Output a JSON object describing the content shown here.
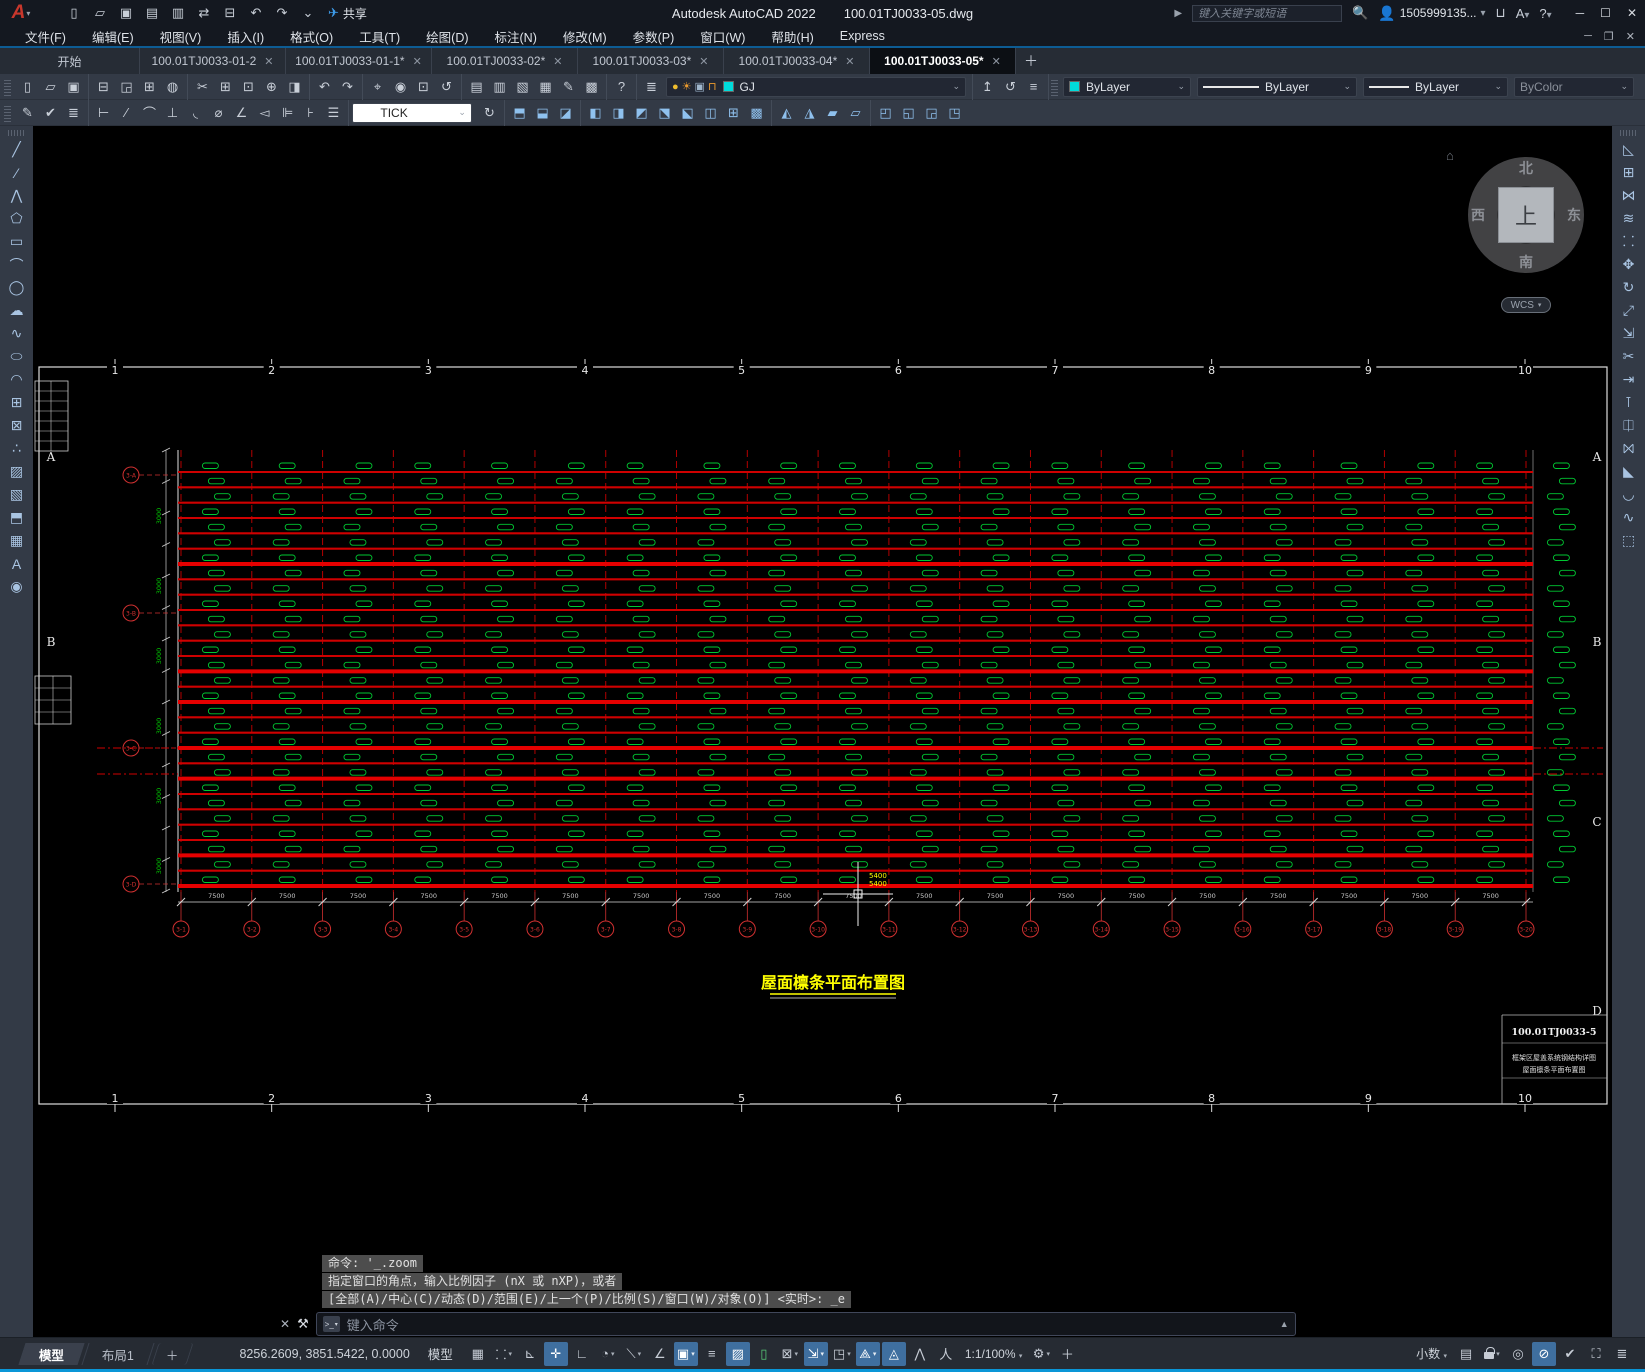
{
  "titlebar": {
    "app_title": "Autodesk AutoCAD 2022",
    "doc_title": "100.01TJ0033-05.dwg",
    "share_label": "共享",
    "search_placeholder": "键入关键字或短语",
    "username": "1505999135...",
    "qat_icons": [
      "new:▯",
      "open:▱",
      "save:▣",
      "save-as:▤",
      "plot-batch:▥",
      "transfer:⇄",
      "print:⊟",
      "undo:↶",
      "redo:↷",
      "customize:⌄"
    ],
    "right_icons": [
      "search:○",
      "user:●",
      "cart:⊔",
      "autodesk-app:A",
      "help:?"
    ],
    "window_controls": [
      "minimize:─",
      "maximize:☐",
      "close:✕"
    ],
    "doc_window_controls": [
      "minimize:─",
      "restore:❐",
      "close:✕"
    ]
  },
  "menubar": {
    "items": [
      "文件(F)",
      "编辑(E)",
      "视图(V)",
      "插入(I)",
      "格式(O)",
      "工具(T)",
      "绘图(D)",
      "标注(N)",
      "修改(M)",
      "参数(P)",
      "窗口(W)",
      "帮助(H)",
      "Express"
    ]
  },
  "tabbar": {
    "start_tab": "开始",
    "tabs": [
      {
        "label": "100.01TJ0033-01-2",
        "active": false
      },
      {
        "label": "100.01TJ0033-01-1*",
        "active": false
      },
      {
        "label": "100.01TJ0033-02*",
        "active": false
      },
      {
        "label": "100.01TJ0033-03*",
        "active": false
      },
      {
        "label": "100.01TJ0033-04*",
        "active": false
      },
      {
        "label": "100.01TJ0033-05*",
        "active": true
      }
    ],
    "close_glyph": "✕",
    "new_tab_glyph": "＋"
  },
  "toolbars": {
    "row1_groups": [
      [
        "new:▯",
        "open:▱",
        "save:▣"
      ],
      [
        "plot:⊟",
        "plot-preview:◲",
        "publish:⊞",
        "publish-web:◍"
      ],
      [
        "cut:✂",
        "copy-clip:⊞",
        "paste:⊡",
        "copy-base-point:⊕",
        "match-properties:◨"
      ],
      [
        "undo:↶",
        "redo:↷"
      ],
      [
        "pan:⌖",
        "zoom-realtime:◉",
        "zoom-window:⊡",
        "zoom-previous:↺"
      ],
      [
        "properties:▤",
        "design-center:▥",
        "tool-palettes:▧",
        "sheet-set-manager:▦",
        "markup:✎",
        "quick-calc:▩"
      ],
      [
        "help:?"
      ]
    ],
    "layer_tools": [
      "layer-properties:≣"
    ],
    "layer_state_tools": [
      "make-object-layer-current:↥",
      "layer-previous:↺",
      "layer-states:≡"
    ],
    "layer": {
      "name": "GJ",
      "swatch_color": "#00dbdb"
    },
    "color_value": "ByLayer",
    "linetype_value": "ByLayer",
    "lineweight_value": "ByLayer",
    "plotstyle_value": "ByColor",
    "dim_style": "TICK",
    "row2_groups_a": [
      [
        "edit-text:✎",
        "check-standards:✔",
        "layer-translate:≣"
      ],
      [
        "dim-linear:⊢",
        "dim-aligned:∕",
        "dim-arc-length:⌒",
        "dim-ordinate:⊥",
        "dim-radius:◟",
        "dim-diameter:⌀",
        "dim-angular:∠",
        "dim-quick:◅",
        "dim-baseline:⊫",
        "dim-continue:⊦",
        "dim-space:☰"
      ]
    ],
    "row2_groups_b": [
      [
        "dim-update:↻"
      ],
      [
        "union:⬒",
        "subtract:⬓",
        "intersect:◪"
      ],
      [
        "extrude-faces:◧",
        "move-faces:◨",
        "offset-faces:◩",
        "delete-faces:⬔",
        "rotate-faces:⬕",
        "taper-faces:◫",
        "copy-faces:⊞",
        "color-faces:▩"
      ],
      [
        "slice:◭",
        "thicken:◮",
        "imprint:▰",
        "check-interference:▱"
      ],
      [
        "clean:◰",
        "shell:◱",
        "separate:◲",
        "validate:◳"
      ]
    ]
  },
  "draw_toolbar": [
    "line:╱",
    "construction-line:⁄",
    "polyline:⋀",
    "polygon:⬠",
    "rectangle:▭",
    "arc:⌒",
    "circle:◯",
    "revision-cloud:☁",
    "spline:∿",
    "ellipse:⬭",
    "ellipse-arc:◠",
    "insert-block:⊞",
    "create-block:⊠",
    "point:∴",
    "hatch:▨",
    "gradient:▧",
    "region:⬒",
    "table:▦",
    "multiline-text:A",
    "point-style:◉"
  ],
  "modify_toolbar": [
    "erase:◺",
    "copy:⊞",
    "mirror:⋈",
    "offset:≋",
    "array:⸬",
    "move:✥",
    "rotate:↻",
    "scale:⤢",
    "stretch:⇲",
    "trim:✂",
    "extend:⇥",
    "break-at-point:⊺",
    "break:⎅",
    "join:⨝",
    "chamfer:◣",
    "fillet:◡",
    "blend-curves:∿",
    "explode:⬚"
  ],
  "viewcube": {
    "north": "北",
    "south": "南",
    "west": "西",
    "east": "东",
    "top_face": "上",
    "wcs_label": "WCS"
  },
  "drawing": {
    "grid_numbers": [
      "1",
      "2",
      "3",
      "4",
      "5",
      "6",
      "7",
      "8",
      "9",
      "10"
    ],
    "left_row_letters": [
      "A",
      "B"
    ],
    "right_row_letters": [
      "A",
      "B",
      "C",
      "D"
    ],
    "sub_axis_labels": [
      "3-1",
      "3-2",
      "3-3",
      "3-4",
      "3-5",
      "3-6",
      "3-7",
      "3-8",
      "3-9",
      "3-10",
      "3-11",
      "3-12",
      "3-13",
      "3-14",
      "3-15",
      "3-16",
      "3-17",
      "3-18",
      "3-19",
      "3-20"
    ],
    "side_axis_labels": [
      "3-A",
      "3-B",
      "3-C",
      "3-D"
    ],
    "bay_dim_label": "7500",
    "left_dim_label": "3000",
    "cursor_dim_label": "5400",
    "title": "屋面檩条平面布置图",
    "titleblock": {
      "drawing_number": "100.01TJ0033-5",
      "line1": "框架区屋盖系统钢结构详图",
      "line2": "屋面檩条平面布置图"
    },
    "purlin_rows": 28,
    "thick_rows": [
      6,
      13,
      15,
      18,
      20,
      25,
      27
    ],
    "bays": 20,
    "colors": {
      "purlin": "#cf0000",
      "purlin_thick": "#e60000",
      "grid_line": "#b30000",
      "tag": "#00c832",
      "axis_bubble": "#d03030",
      "dim_text": "#c8c8c8",
      "frame": "#dcdcdc",
      "title": "#ffff00",
      "green_dim": "#00bb00"
    }
  },
  "command": {
    "history": [
      "命令: '_.zoom",
      "指定窗口的角点，输入比例因子 (nX 或 nXP)，或者",
      "[全部(A)/中心(C)/动态(D)/范围(E)/上一个(P)/比例(S)/窗口(W)/对象(O)] <实时>: _e"
    ],
    "input_placeholder": "键入命令"
  },
  "statusbar": {
    "layout_tabs": [
      "模型",
      "布局1"
    ],
    "new_layout_glyph": "＋",
    "coordinates": "8256.2609, 3851.5422, 0.0000",
    "model_space_label": "模型",
    "toggles": [
      {
        "name": "grid-display",
        "glyph": "▦",
        "active": false,
        "dd": false
      },
      {
        "name": "snap-mode",
        "glyph": "⸬",
        "active": false,
        "dd": true
      },
      {
        "name": "infer-constraints",
        "glyph": "⊾",
        "active": false,
        "dd": false
      },
      {
        "name": "dynamic-input",
        "glyph": "✛",
        "active": true,
        "dd": false
      },
      {
        "name": "ortho-mode",
        "glyph": "∟",
        "active": false,
        "dd": false
      },
      {
        "name": "polar-tracking",
        "glyph": "◔",
        "active": false,
        "dd": true
      },
      {
        "name": "isometric-drafting",
        "glyph": "⟍",
        "active": false,
        "dd": true
      },
      {
        "name": "object-snap-tracking",
        "glyph": "∠",
        "active": false,
        "dd": false
      },
      {
        "name": "object-snap",
        "glyph": "▣",
        "active": true,
        "dd": true
      },
      {
        "name": "lineweight",
        "glyph": "≡",
        "active": false,
        "dd": false
      },
      {
        "name": "transparency",
        "glyph": "▨",
        "active": true,
        "dd": false
      },
      {
        "name": "selection-cycling",
        "glyph": "▯",
        "active": false,
        "dd": false,
        "green": true
      },
      {
        "name": "3d-object-snap",
        "glyph": "⊠",
        "active": false,
        "dd": true
      },
      {
        "name": "dynamic-ucs",
        "glyph": "⇲",
        "active": true,
        "dd": true
      },
      {
        "name": "selection-filtering",
        "glyph": "◳",
        "active": false,
        "dd": true
      },
      {
        "name": "gizmo",
        "glyph": "⟁",
        "active": true,
        "dd": true
      },
      {
        "name": "annotation-visibility",
        "glyph": "◬",
        "active": true,
        "dd": false
      },
      {
        "name": "autoscale",
        "glyph": "⋀",
        "active": false,
        "dd": false
      },
      {
        "name": "annotation-scale-flag",
        "glyph": "人",
        "active": false,
        "dd": false
      }
    ],
    "annotation_scale": "1:1/100%",
    "settings_glyph": "⚙",
    "add_glyph": "＋",
    "units_label": "小数",
    "right_icons": [
      {
        "name": "properties-palette",
        "glyph": "▤",
        "active": false,
        "dd": false
      },
      {
        "name": "lock-ui",
        "glyph": "lock",
        "active": false,
        "dd": true
      },
      {
        "name": "isolate-objects",
        "glyph": "◎",
        "active": false,
        "dd": false
      },
      {
        "name": "annotation-monitor",
        "glyph": "⊘",
        "active": true,
        "dd": false
      },
      {
        "name": "graphics-performance",
        "glyph": "✔",
        "active": false,
        "dd": false
      },
      {
        "name": "clean-screen",
        "glyph": "⛶",
        "active": false,
        "dd": false
      },
      {
        "name": "customization-menu",
        "glyph": "≣",
        "active": false,
        "dd": false
      }
    ]
  }
}
